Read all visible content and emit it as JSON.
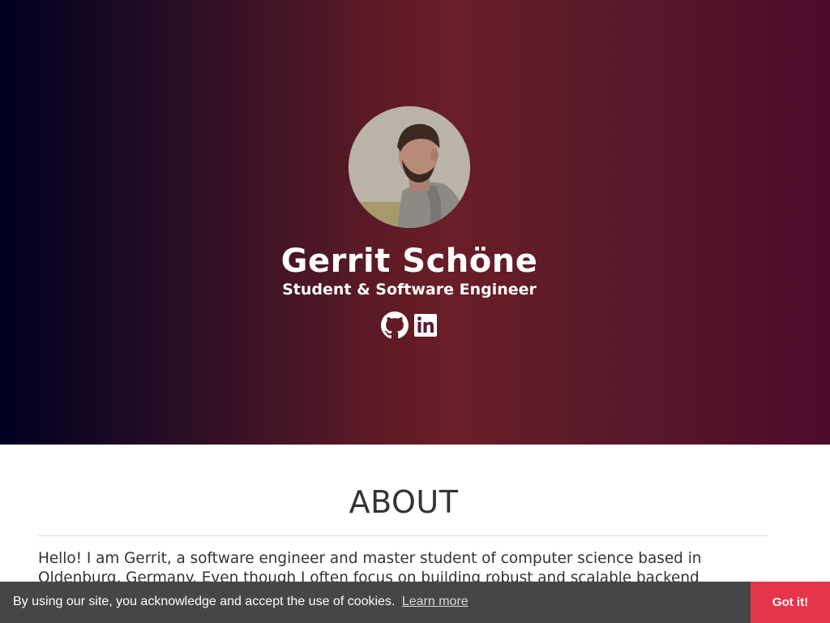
{
  "profile": {
    "name": "Gerrit Schöne",
    "subtitle": "Student & Software Engineer",
    "avatar_alt": "Profile photo"
  },
  "social": [
    {
      "label": "GitHub",
      "icon": "github-icon"
    },
    {
      "label": "LinkedIn",
      "icon": "linkedin-icon"
    }
  ],
  "about": {
    "title": "ABOUT",
    "text": "Hello! I am Gerrit, a software engineer and master student of computer science based in Oldenburg, Germany. Even though I often focus on building robust and scalable backend"
  },
  "cookie": {
    "message": "By using our site, you acknowledge and accept the use of cookies.",
    "learn_more": "Learn more",
    "accept": "Got it!"
  },
  "colors": {
    "accent": "#e5354b",
    "cookie_bg": "#464646",
    "hero_left": "#000022",
    "hero_mid": "#6a1e27",
    "hero_right": "#4e0a2a"
  }
}
